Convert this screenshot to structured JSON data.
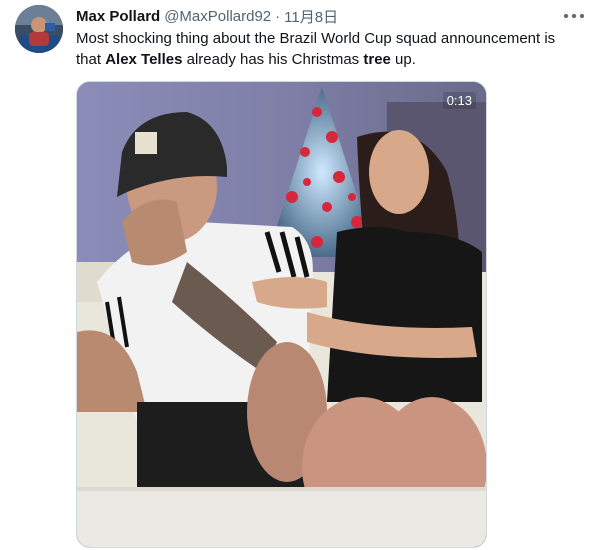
{
  "tweet": {
    "display_name": "Max Pollard",
    "handle": "@MaxPollard92",
    "separator": "·",
    "date": "11月8日",
    "text_before_1": "Most shocking thing about the Brazil World Cup squad announcement is that ",
    "bold_1": "Alex Telles",
    "text_between": " already has his Christmas ",
    "bold_2": "tree",
    "text_after": " up.",
    "more_icon": "more-horizontal-icon"
  },
  "media": {
    "type": "video",
    "duration": "0:13"
  },
  "colors": {
    "text_primary": "#0f1419",
    "text_secondary": "#536471",
    "border": "#cfd9de"
  }
}
